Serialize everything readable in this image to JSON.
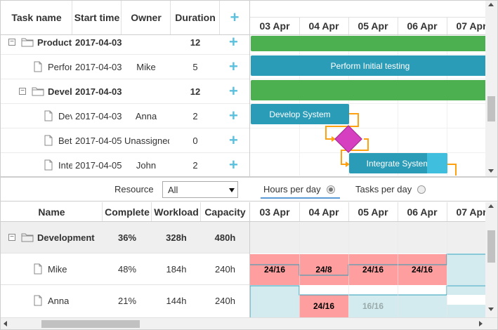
{
  "grid": {
    "columns": {
      "task_name": "Task name",
      "start_time": "Start time",
      "owner": "Owner",
      "duration": "Duration"
    },
    "add_icon": "plus-icon",
    "rows": [
      {
        "name": "Product",
        "start": "2017-04-03",
        "owner": "",
        "duration": "12",
        "level": 0,
        "type": "project",
        "toggle": "−",
        "bold": true
      },
      {
        "name": "Perform Initial testing",
        "start": "2017-04-03",
        "owner": "Mike",
        "duration": "5",
        "level": 1,
        "type": "task",
        "toggle": "",
        "bold": false
      },
      {
        "name": "Development",
        "start": "2017-04-03",
        "owner": "",
        "duration": "12",
        "level": 1,
        "type": "project",
        "toggle": "−",
        "bold": true
      },
      {
        "name": "Develop System",
        "start": "2017-04-03",
        "owner": "Anna",
        "duration": "2",
        "level": 2,
        "type": "task",
        "toggle": "",
        "bold": false
      },
      {
        "name": "Beta Release",
        "start": "2017-04-05",
        "owner": "Unassigned",
        "duration": "0",
        "level": 2,
        "type": "task",
        "toggle": "",
        "bold": false
      },
      {
        "name": "Integrate System",
        "start": "2017-04-05",
        "owner": "John",
        "duration": "2",
        "level": 2,
        "type": "task",
        "toggle": "",
        "bold": false
      }
    ]
  },
  "timeline": {
    "scale": [
      "03 Apr",
      "04 Apr",
      "05 Apr",
      "06 Apr",
      "07 Apr"
    ],
    "bars": [
      {
        "label": "",
        "color": "#4caf50"
      },
      {
        "label": "Perform Initial testing",
        "color": "#2b9cb8"
      },
      {
        "label": "",
        "color": "#4caf50"
      },
      {
        "label": "Develop System",
        "color": "#2b9cb8"
      },
      {
        "label": "",
        "color": "#d63fbf"
      },
      {
        "label": "Integrate System",
        "color": "#2b9cb8"
      }
    ],
    "link_color": "#ffa011"
  },
  "toolbar": {
    "resource_label": "Resource",
    "resource_value": "All",
    "hours_label": "Hours per day",
    "tasks_label": "Tasks per day"
  },
  "resources": {
    "columns": {
      "name": "Name",
      "complete": "Complete",
      "workload": "Workload",
      "capacity": "Capacity"
    },
    "rows": [
      {
        "name": "Development",
        "complete": "36%",
        "workload": "328h",
        "capacity": "480h",
        "group": true
      },
      {
        "name": "Mike",
        "complete": "48%",
        "workload": "184h",
        "capacity": "240h",
        "group": false
      },
      {
        "name": "Anna",
        "complete": "21%",
        "workload": "144h",
        "capacity": "240h",
        "group": false
      }
    ],
    "scale": [
      "03 Apr",
      "04 Apr",
      "05 Apr",
      "06 Apr",
      "07 Apr"
    ],
    "mike_cells": [
      "24/16",
      "24/8",
      "24/16",
      "24/16"
    ],
    "anna_cells": [
      "",
      "24/16",
      "16/16"
    ]
  },
  "colors": {
    "accent": "#5bc0de",
    "overload": "#ff9e9e",
    "normal": "#d3ebee",
    "project": "#4caf50",
    "task": "#2b9cb8",
    "milestone": "#d63fbf"
  }
}
